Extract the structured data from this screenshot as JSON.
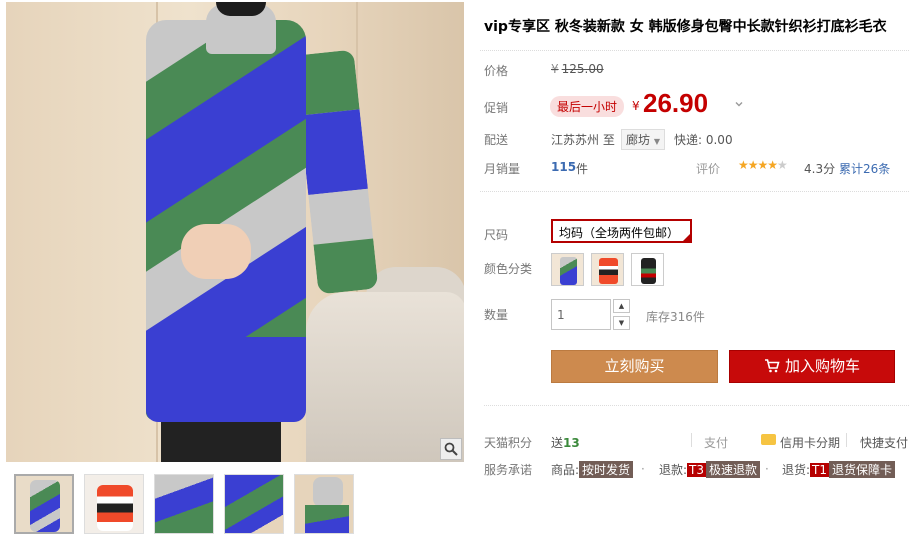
{
  "product": {
    "title": "vip专享区 秋冬装新款 女 韩版修身包臀中长款针织衫打底衫毛衣"
  },
  "price": {
    "label": "价格",
    "currency": "¥",
    "original": "125.00"
  },
  "promo": {
    "label": "促销",
    "tag": "最后一小时",
    "currency": "¥",
    "price": "26.90",
    "expand_icon": "chevron-down-icon"
  },
  "shipping": {
    "label": "配送",
    "from": "江苏苏州 至",
    "to": "廊坊",
    "fee": "快递: 0.00"
  },
  "sales": {
    "label": "月销量",
    "count": "115",
    "unit": "件",
    "review_label": "评价",
    "rating": 4.3,
    "stars_full": "★★★★",
    "stars_empty": "★",
    "score": "4.3分",
    "total": "累计26条"
  },
  "size": {
    "label": "尺码",
    "selected": "均码（全场两件包邮）"
  },
  "color": {
    "label": "颜色分类",
    "options": [
      "swatch-1",
      "swatch-2",
      "swatch-3"
    ]
  },
  "quantity": {
    "label": "数量",
    "value": "1",
    "stock": "库存316件"
  },
  "buttons": {
    "buy": "立刻购买",
    "cart": "加入购物车"
  },
  "points": {
    "label": "天猫积分",
    "prefix": "送",
    "value": "13",
    "pay_label": "支付",
    "credit": "信用卡分期",
    "quick": "快捷支付"
  },
  "service": {
    "label": "服务承诺",
    "item1_prefix": "商品:",
    "item1_tag": "按时发货",
    "item2_prefix": "退款:",
    "item2_badge": "T3",
    "item2_tag": "极速退款",
    "item3_prefix": "退货:",
    "item3_badge": "T1",
    "item3_tag": "退货保障卡",
    "dot": "·"
  },
  "colors": {
    "accent_red": "#c40000",
    "buy_button": "#cd8a4e",
    "cart_button": "#c70a0a",
    "link_blue": "#3c6bb1"
  }
}
